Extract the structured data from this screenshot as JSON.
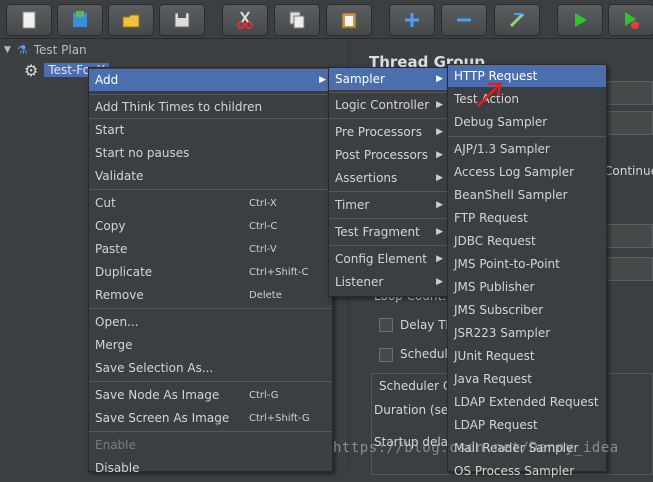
{
  "toolbar": {
    "buttons": [
      {
        "name": "new-icon"
      },
      {
        "name": "templates-icon"
      },
      {
        "name": "open-icon"
      },
      {
        "name": "save-icon"
      },
      {
        "name": "cut-icon"
      },
      {
        "name": "copy-icon"
      },
      {
        "name": "paste-icon"
      },
      {
        "name": "expand-icon"
      },
      {
        "name": "collapse-icon"
      },
      {
        "name": "toggle-icon"
      },
      {
        "name": "start-icon"
      },
      {
        "name": "start-no-pauses-icon"
      }
    ]
  },
  "tree": {
    "root": "Test Plan",
    "child": "Test-For-Y"
  },
  "right_panel": {
    "title": "Thread Group",
    "continue_text": "Continue",
    "loop_count": "Loop Count:",
    "delay_thread": "Delay Th",
    "scheduler_check": "Schedule",
    "scheduler_config": "Scheduler C",
    "duration": "Duration (sec",
    "startup_delay": "Startup delay"
  },
  "context_menu": {
    "items": [
      {
        "label": "Add",
        "shortcut": "",
        "submenu": true
      },
      {
        "label": "Add Think Times to children",
        "shortcut": ""
      },
      {
        "label": "Start",
        "shortcut": ""
      },
      {
        "label": "Start no pauses",
        "shortcut": ""
      },
      {
        "label": "Validate",
        "shortcut": ""
      },
      {
        "label": "Cut",
        "shortcut": "Ctrl-X"
      },
      {
        "label": "Copy",
        "shortcut": "Ctrl-C"
      },
      {
        "label": "Paste",
        "shortcut": "Ctrl-V"
      },
      {
        "label": "Duplicate",
        "shortcut": "Ctrl+Shift-C"
      },
      {
        "label": "Remove",
        "shortcut": "Delete"
      },
      {
        "label": "Open...",
        "shortcut": ""
      },
      {
        "label": "Merge",
        "shortcut": ""
      },
      {
        "label": "Save Selection As...",
        "shortcut": ""
      },
      {
        "label": "Save Node As Image",
        "shortcut": "Ctrl-G"
      },
      {
        "label": "Save Screen As Image",
        "shortcut": "Ctrl+Shift-G"
      },
      {
        "label": "Enable",
        "shortcut": ""
      },
      {
        "label": "Disable",
        "shortcut": ""
      }
    ]
  },
  "add_submenu": {
    "items": [
      {
        "label": "Sampler"
      },
      {
        "label": "Logic Controller"
      },
      {
        "label": "Pre Processors"
      },
      {
        "label": "Post Processors"
      },
      {
        "label": "Assertions"
      },
      {
        "label": "Timer"
      },
      {
        "label": "Test Fragment"
      },
      {
        "label": "Config Element"
      },
      {
        "label": "Listener"
      }
    ]
  },
  "sampler_submenu": {
    "items": [
      "HTTP Request",
      "Test Action",
      "Debug Sampler",
      "AJP/1.3 Sampler",
      "Access Log Sampler",
      "BeanShell Sampler",
      "FTP Request",
      "JDBC Request",
      "JMS Point-to-Point",
      "JMS Publisher",
      "JMS Subscriber",
      "JSR223 Sampler",
      "JUnit Request",
      "Java Request",
      "LDAP Extended Request",
      "LDAP Request",
      "Mail Reader Sampler",
      "OS Process Sampler"
    ]
  },
  "watermark": "https://blog.csdn.net/Danny_idea"
}
